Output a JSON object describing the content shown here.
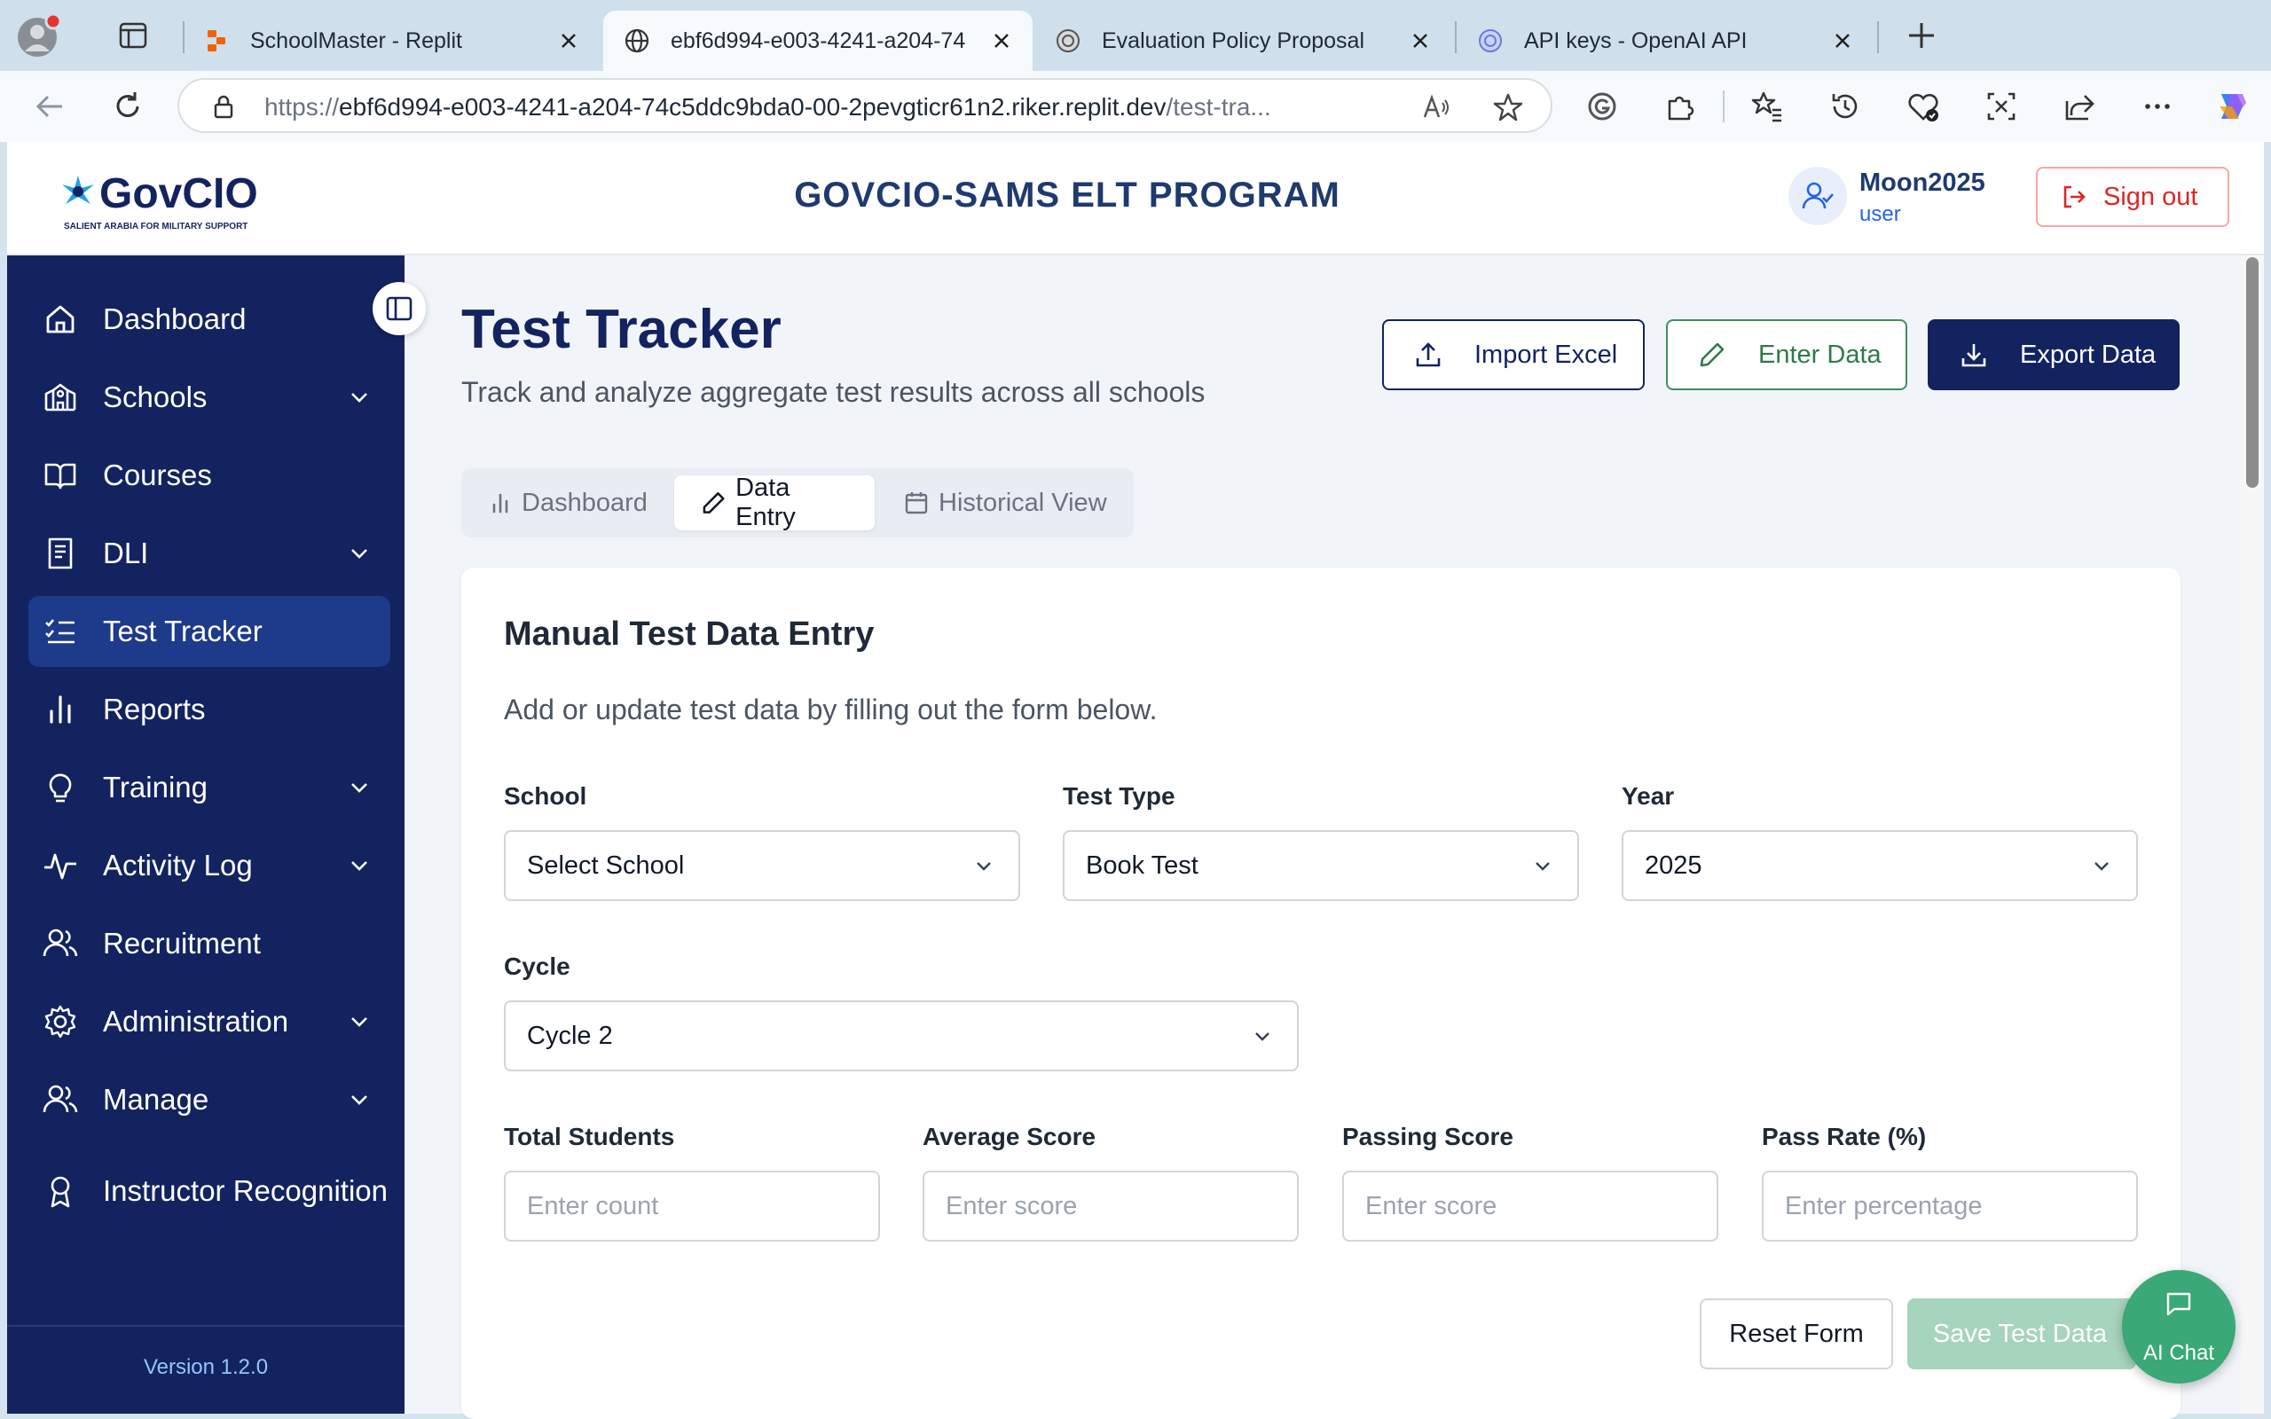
{
  "browser": {
    "tabs": [
      {
        "title": "SchoolMaster - Replit",
        "active": false
      },
      {
        "title": "ebf6d994-e003-4241-a204-74",
        "active": true
      },
      {
        "title": "Evaluation Policy Proposal",
        "active": false
      },
      {
        "title": "API keys - OpenAI API",
        "active": false
      }
    ],
    "url_prefix": "https://",
    "url_host": "ebf6d994-e003-4241-a204-74c5ddc9bda0-00-2pevgticr61n2.riker.replit.dev",
    "url_path": "/test-tra..."
  },
  "header": {
    "logo_text": "GovCIO",
    "logo_tagline": "SALIENT ARABIA FOR MILITARY SUPPORT",
    "app_title": "GOVCIO-SAMS ELT PROGRAM",
    "user_name": "Moon2025",
    "user_role": "user",
    "signout_label": "Sign out"
  },
  "sidebar": {
    "items": [
      {
        "label": "Dashboard",
        "icon": "home-icon",
        "has_chevron": false,
        "active": false
      },
      {
        "label": "Schools",
        "icon": "school-icon",
        "has_chevron": true,
        "active": false
      },
      {
        "label": "Courses",
        "icon": "book-open-icon",
        "has_chevron": false,
        "active": false
      },
      {
        "label": "DLI",
        "icon": "book-icon",
        "has_chevron": true,
        "active": false
      },
      {
        "label": "Test Tracker",
        "icon": "list-checks-icon",
        "has_chevron": false,
        "active": true
      },
      {
        "label": "Reports",
        "icon": "bar-chart-icon",
        "has_chevron": false,
        "active": false
      },
      {
        "label": "Training",
        "icon": "lightbulb-icon",
        "has_chevron": true,
        "active": false
      },
      {
        "label": "Activity Log",
        "icon": "activity-icon",
        "has_chevron": true,
        "active": false
      },
      {
        "label": "Recruitment",
        "icon": "users-icon",
        "has_chevron": false,
        "active": false
      },
      {
        "label": "Administration",
        "icon": "gear-icon",
        "has_chevron": true,
        "active": false
      },
      {
        "label": "Manage",
        "icon": "users-icon",
        "has_chevron": true,
        "active": false
      },
      {
        "label": "Instructor Recognition",
        "icon": "award-icon",
        "has_chevron": false,
        "active": false
      }
    ],
    "version": "Version 1.2.0"
  },
  "page": {
    "title": "Test Tracker",
    "subtitle": "Track and analyze aggregate test results across all schools",
    "import_label": "Import Excel",
    "enter_label": "Enter Data",
    "export_label": "Export Data",
    "tabs": [
      {
        "label": "Dashboard",
        "icon": "bar-chart-icon",
        "active": false
      },
      {
        "label": "Data Entry",
        "icon": "pencil-icon",
        "active": true
      },
      {
        "label": "Historical View",
        "icon": "calendar-icon",
        "active": false
      }
    ]
  },
  "form": {
    "title": "Manual Test Data Entry",
    "description": "Add or update test data by filling out the form below.",
    "school": {
      "label": "School",
      "value": "Select School"
    },
    "test_type": {
      "label": "Test Type",
      "value": "Book Test"
    },
    "year": {
      "label": "Year",
      "value": "2025"
    },
    "cycle": {
      "label": "Cycle",
      "value": "Cycle 2"
    },
    "total_students": {
      "label": "Total Students",
      "placeholder": "Enter count"
    },
    "average_score": {
      "label": "Average Score",
      "placeholder": "Enter score"
    },
    "passing_score": {
      "label": "Passing Score",
      "placeholder": "Enter score"
    },
    "pass_rate": {
      "label": "Pass Rate (%)",
      "placeholder": "Enter percentage"
    },
    "reset_label": "Reset Form",
    "save_label": "Save Test Data"
  },
  "ai_chat": {
    "label": "AI Chat"
  },
  "colors": {
    "sidebar_bg": "#13235f",
    "sidebar_active": "#1e3a8a",
    "primary": "#13235f",
    "success": "#2f7a4a",
    "danger": "#dc2626",
    "chat": "#3aa877"
  }
}
